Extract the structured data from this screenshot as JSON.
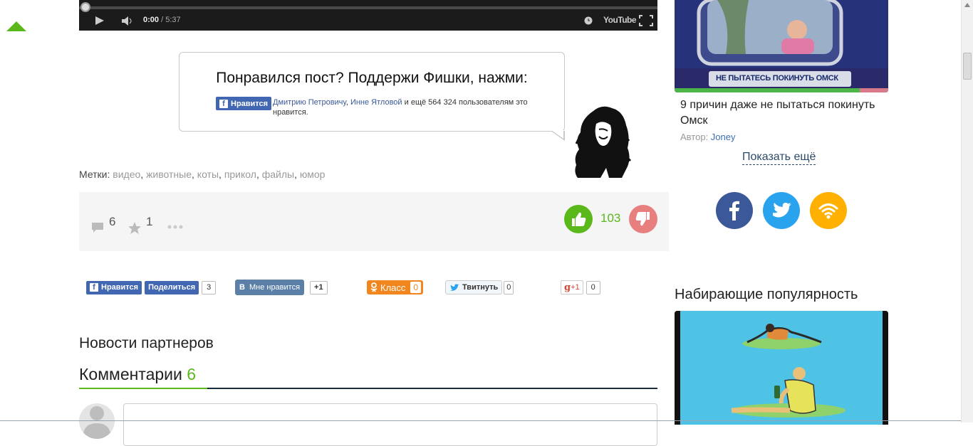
{
  "video": {
    "time_current": "0:00",
    "time_total": " / 5:37",
    "progress": 0.0,
    "youtube_label": "YouTube"
  },
  "promo": {
    "title": "Понравился пост? Поддержи Фишки, нажми:",
    "like_label": "Нравится",
    "friend1": "Дмитрию Петровичу",
    "sep": ", ",
    "friend2": "Инне Ятловой",
    "text_rest": " и ещё 564 324 пользователям это нравится."
  },
  "tags": {
    "label": "Метки:",
    "items": [
      "видео",
      "животные",
      "коты",
      "прикол",
      "файлы",
      "юмор"
    ]
  },
  "stats": {
    "comments": "6",
    "favorites": "1",
    "rating": "103"
  },
  "share": {
    "fb_like": "Нравится",
    "fb_share": "Поделиться",
    "fb_count": "3",
    "vk_label": "Мне нравится",
    "vk_count": "+1",
    "ok_label": "Класс",
    "ok_count": "0",
    "tw_label": "Твитнуть",
    "tw_count": "0",
    "gp_label": "+1",
    "gp_count": "0"
  },
  "partners_title": "Новости партнеров",
  "comments": {
    "title": "Комментарии",
    "count": "6"
  },
  "sidebar": {
    "sign_text": "НЕ ПЫТАТЕСЬ ПОКИНУТЬ ОМСК",
    "article_title": "9 причин даже не пытаться покинуть Омск",
    "author_label": "Автор:",
    "author": "Joney",
    "show_more": "Показать ещё",
    "popular_title": "Набирающие популярность"
  },
  "colors": {
    "accent_green": "#5ab81a",
    "facebook": "#3b5998",
    "twitter": "#2aa3ef",
    "rss": "#ffb000",
    "dislike": "#e87f7f"
  }
}
